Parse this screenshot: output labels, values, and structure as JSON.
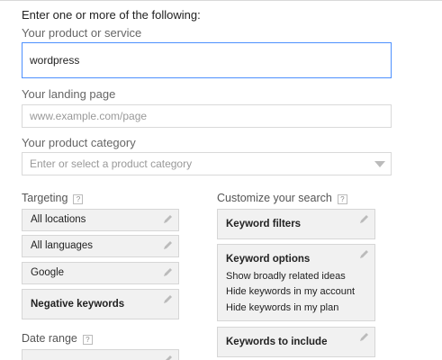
{
  "form": {
    "heading": "Enter one or more of the following:",
    "product_label": "Your product or service",
    "product_value": "wordpress",
    "landing_label": "Your landing page",
    "landing_placeholder": "www.example.com/page",
    "category_label": "Your product category",
    "category_placeholder": "Enter or select a product category"
  },
  "targeting": {
    "label": "Targeting",
    "help": "?",
    "items": [
      {
        "label": "All locations"
      },
      {
        "label": "All languages"
      },
      {
        "label": "Google"
      },
      {
        "label": "Negative keywords"
      }
    ]
  },
  "customize": {
    "label": "Customize your search",
    "help": "?",
    "keyword_filters": "Keyword filters",
    "keyword_options": {
      "title": "Keyword options",
      "lines": [
        "Show broadly related ideas",
        "Hide keywords in my account",
        "Hide keywords in my plan"
      ]
    },
    "keywords_to_include": "Keywords to include"
  },
  "date_range": {
    "label": "Date range",
    "help": "?"
  },
  "colors": {
    "focus_border": "#4d90fe",
    "card_bg": "#f1f1f1"
  }
}
